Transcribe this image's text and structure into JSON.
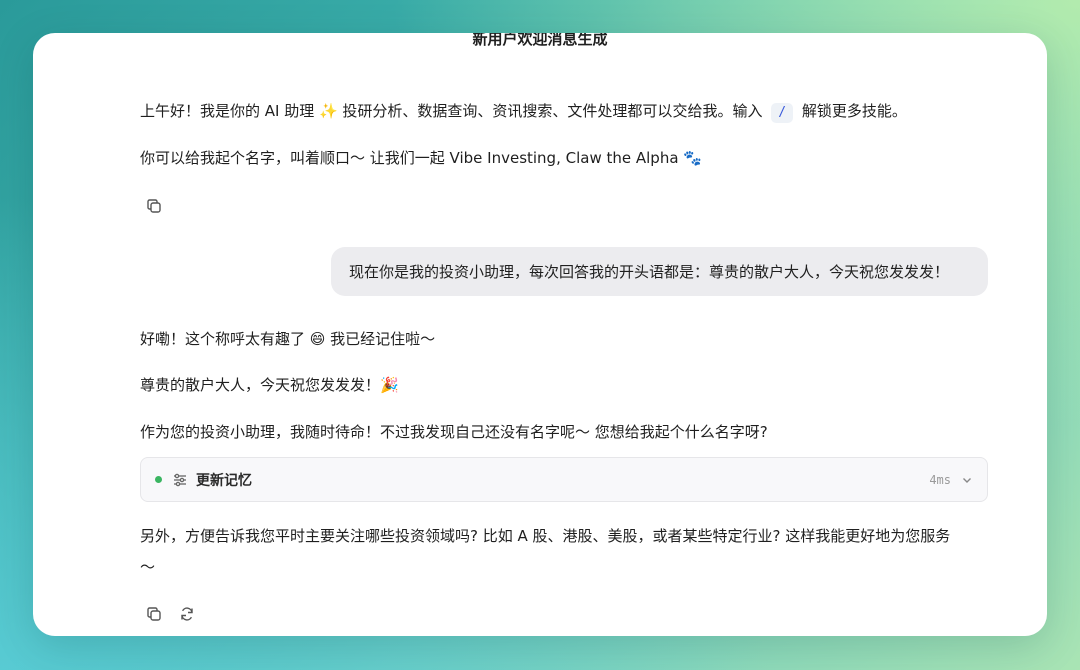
{
  "header": {
    "title": "新用户欢迎消息生成"
  },
  "messages": {
    "assistant_1": {
      "line1_before": "上午好！我是你的 AI 助理 ✨ 投研分析、数据查询、资讯搜索、文件处理都可以交给我。输入",
      "slash": "/",
      "line1_after": "解锁更多技能。",
      "line2": "你可以给我起个名字，叫着顺口～ 让我们一起 Vibe Investing, Claw the Alpha 🐾"
    },
    "user_1": {
      "text": "现在你是我的投资小助理，每次回答我的开头语都是：尊贵的散户大人，今天祝您发发发！"
    },
    "assistant_2": {
      "line1": "好嘞！这个称呼太有趣了 😄 我已经记住啦～",
      "line2": "尊贵的散户大人，今天祝您发发发！🎉",
      "line3": "作为您的投资小助理，我随时待命！不过我发现自己还没有名字呢～ 您想给我起个什么名字呀?",
      "memory_tool": {
        "label": "更新记忆",
        "time": "4ms"
      },
      "line4a": "另外，方便告诉我您平时主要关注哪些投资领域吗? 比如 A 股、港股、美股，或者某些特定行业? 这样我能更好地为您服务",
      "line4b": "～"
    }
  },
  "icons": {
    "copy": "copy-icon",
    "regenerate": "refresh-icon",
    "memory": "sliders-icon",
    "expand": "chevron-down-icon"
  },
  "colors": {
    "status_dot": "#3ab561",
    "slash_text": "#3b5bdb",
    "user_bubble": "#ececef"
  }
}
